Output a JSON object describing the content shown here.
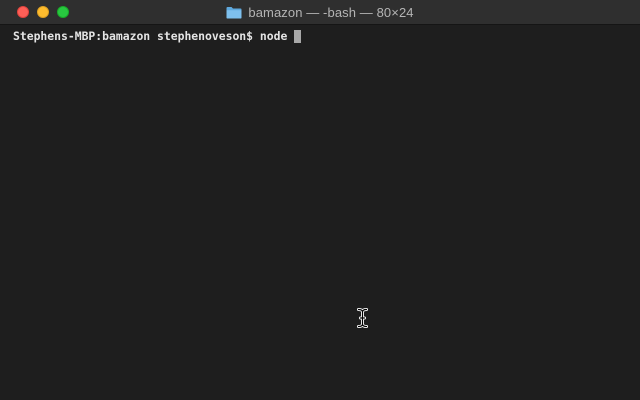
{
  "window": {
    "title": "bamazon — -bash — 80×24",
    "title_icon": "folder-icon",
    "controls": [
      "close",
      "minimize",
      "zoom"
    ],
    "colors": {
      "close": "#fe5f57",
      "minimize": "#febc2e",
      "zoom": "#28c840",
      "terminal_background": "#1e1e1e",
      "text": "#e4e4e4"
    }
  },
  "terminal": {
    "prompt": "Stephens-MBP:bamazon stephenoveson$ ",
    "command": "node ",
    "cursor": "block-cursor",
    "mouse_pointer": "ibeam-cursor-icon"
  }
}
